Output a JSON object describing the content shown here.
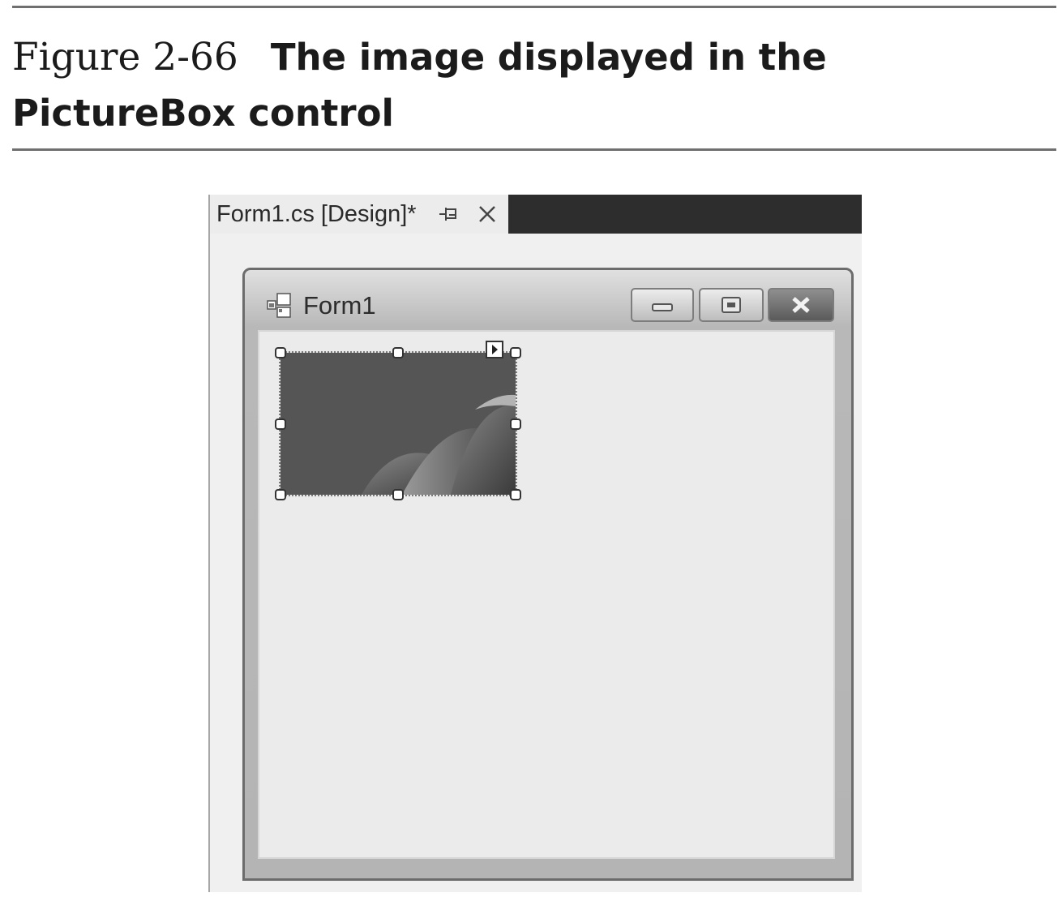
{
  "caption": {
    "figure_label": "Figure 2-66",
    "title": "The image displayed in the PictureBox control"
  },
  "designer": {
    "tab": {
      "label": "Form1.cs [Design]*",
      "icons": [
        "pin-icon",
        "close-icon"
      ]
    },
    "form": {
      "title": "Form1",
      "icon": "form-icon",
      "buttons": [
        "minimize",
        "maximize",
        "close"
      ]
    },
    "picturebox": {
      "selected": true,
      "image": "gray abstract image with curved shapes"
    }
  },
  "colors": {
    "caption_text": "#1b1b1b",
    "rule": "#6f6f6f",
    "tab_dark": "#2d2d2d",
    "picture_bg": "#525252"
  }
}
